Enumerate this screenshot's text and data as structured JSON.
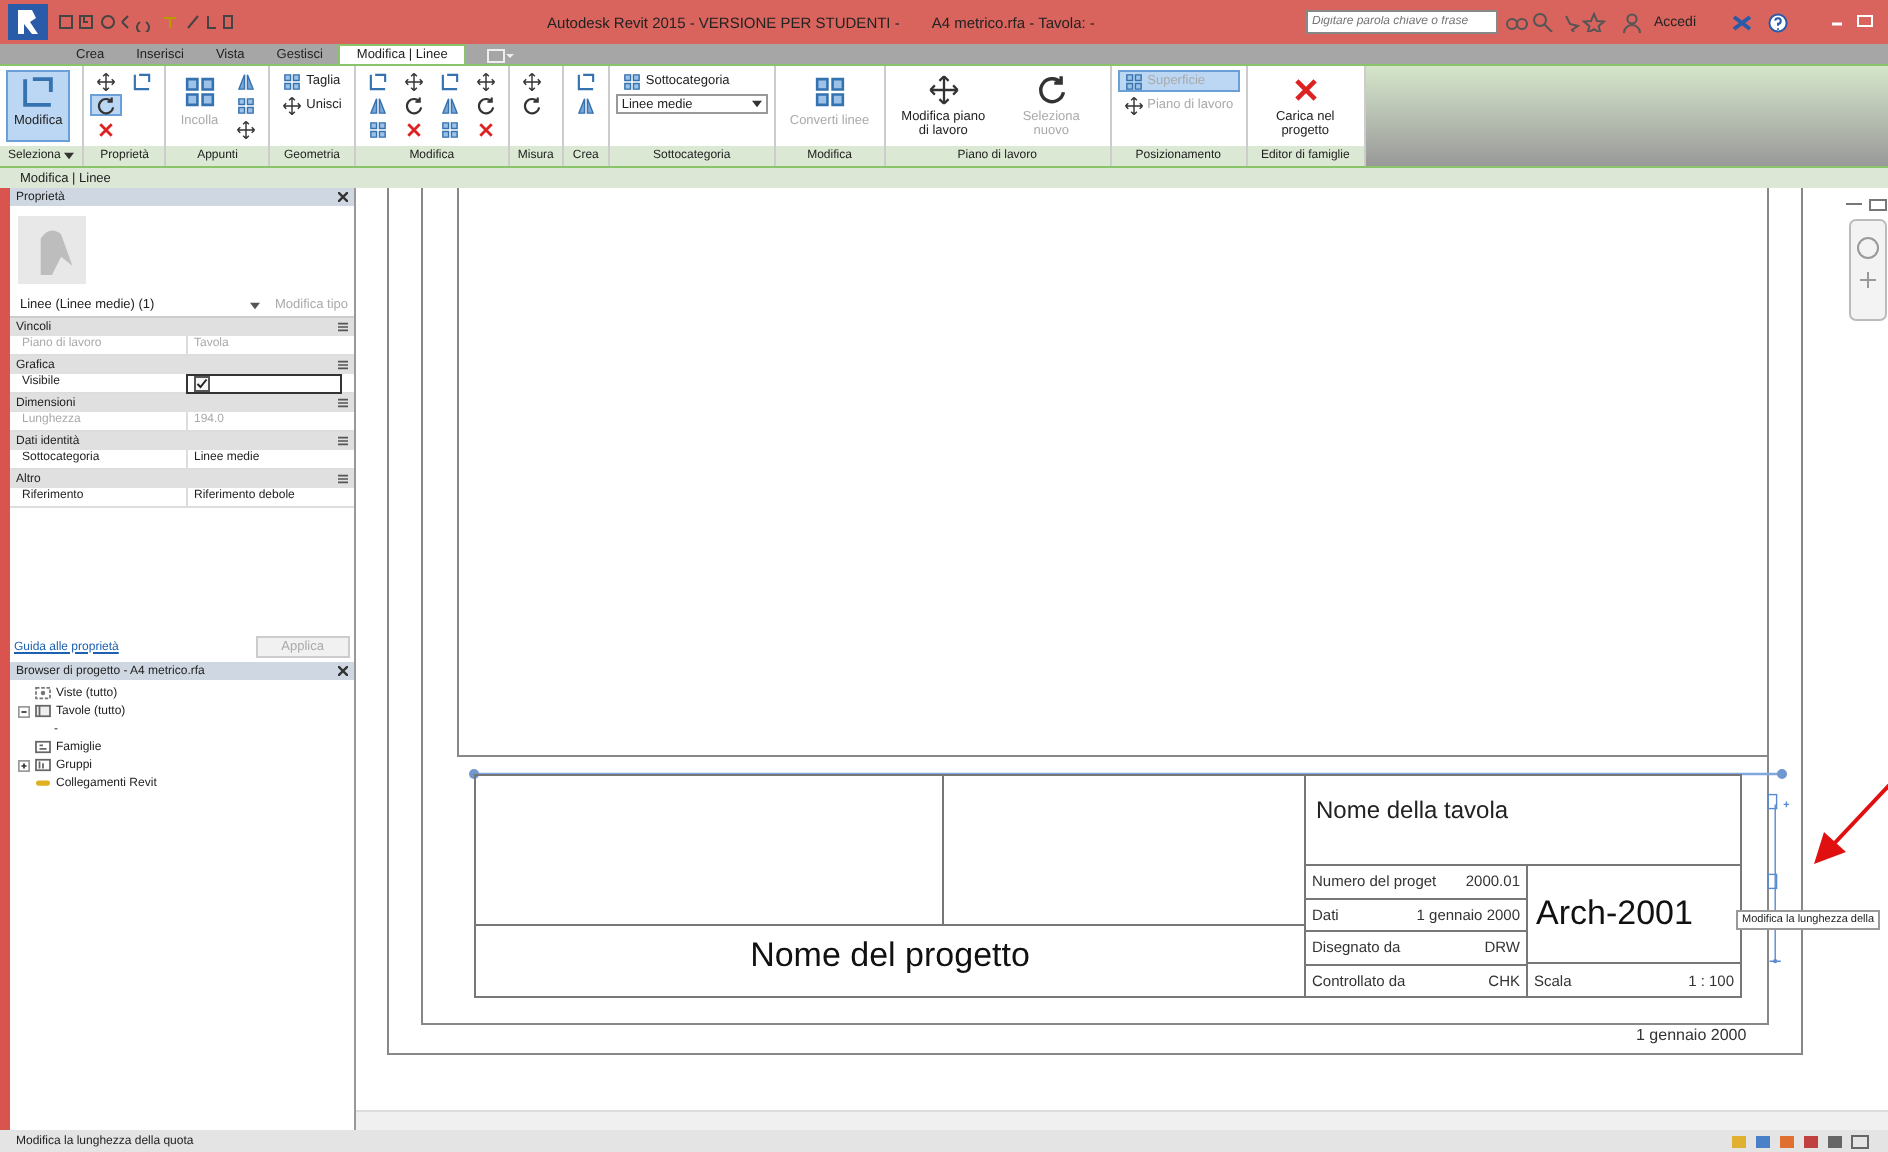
{
  "window": {
    "title": "Autodesk Revit 2015 - VERSIONE PER STUDENTI -",
    "document": "A4 metrico.rfa - Tavola: -"
  },
  "search": {
    "placeholder": "Digitare parola chiave o frase"
  },
  "sign_in": "Accedi",
  "tabs": [
    {
      "label": "Crea",
      "selected": false
    },
    {
      "label": "Inserisci",
      "selected": false
    },
    {
      "label": "Vista",
      "selected": false
    },
    {
      "label": "Gestisci",
      "selected": false
    },
    {
      "label": "Modifica | Linee",
      "selected": true
    }
  ],
  "ribbon": [
    {
      "label": "Seleziona",
      "menu": true,
      "items": [
        {
          "kind": "large",
          "label": "Modifica",
          "selected": true,
          "disabled": false
        }
      ]
    },
    {
      "label": "Proprietà",
      "items": [
        {
          "kind": "tool",
          "selected": false
        },
        {
          "kind": "tool",
          "selected": true
        },
        {
          "kind": "tool",
          "selected": false
        },
        {
          "kind": "tool",
          "selected": false
        }
      ]
    },
    {
      "label": "Appunti",
      "items": [
        {
          "kind": "large",
          "label": "Incolla",
          "selected": false,
          "disabled": true
        },
        {
          "kind": "tool",
          "selected": false
        },
        {
          "kind": "tool",
          "selected": false
        },
        {
          "kind": "tool",
          "selected": false
        }
      ]
    },
    {
      "label": "Geometria",
      "items": [
        {
          "kind": "small",
          "label": "Taglia",
          "selected": false,
          "disabled": false
        },
        {
          "kind": "small",
          "label": "Unisci",
          "selected": false,
          "disabled": false
        }
      ]
    },
    {
      "label": "Modifica",
      "items": [
        {
          "kind": "tool",
          "selected": false
        },
        {
          "kind": "tool",
          "selected": false
        },
        {
          "kind": "tool",
          "selected": false
        },
        {
          "kind": "tool",
          "selected": false
        },
        {
          "kind": "tool",
          "selected": false
        },
        {
          "kind": "tool",
          "selected": false
        },
        {
          "kind": "tool",
          "selected": false
        },
        {
          "kind": "tool",
          "selected": false
        },
        {
          "kind": "tool",
          "selected": false
        },
        {
          "kind": "tool",
          "selected": false
        },
        {
          "kind": "tool",
          "selected": false
        },
        {
          "kind": "tool",
          "selected": false
        }
      ]
    },
    {
      "label": "Misura",
      "items": [
        {
          "kind": "tool",
          "selected": false
        },
        {
          "kind": "tool",
          "selected": false
        }
      ]
    },
    {
      "label": "Crea",
      "items": [
        {
          "kind": "tool",
          "selected": false
        },
        {
          "kind": "tool",
          "selected": false
        }
      ]
    },
    {
      "label": "Sottocategoria",
      "items": [
        {
          "kind": "small",
          "label": "Sottocategoria",
          "selected": false,
          "disabled": false
        },
        {
          "kind": "dropdown",
          "label": "Linee medie"
        }
      ]
    },
    {
      "label": "Modifica",
      "items": [
        {
          "kind": "large",
          "label": "Converti linee",
          "selected": false,
          "disabled": true
        }
      ]
    },
    {
      "label": "Piano di lavoro",
      "items": [
        {
          "kind": "large",
          "label": "Modifica piano di lavoro",
          "selected": false,
          "disabled": false
        },
        {
          "kind": "large",
          "label": "Seleziona nuovo",
          "selected": false,
          "disabled": true
        }
      ]
    },
    {
      "label": "Posizionamento",
      "items": [
        {
          "kind": "small",
          "label": "Superficie",
          "selected": true,
          "disabled": true
        },
        {
          "kind": "small",
          "label": "Piano di lavoro",
          "selected": false,
          "disabled": true
        }
      ]
    },
    {
      "label": "Editor di famiglie",
      "items": [
        {
          "kind": "large",
          "label": "Carica nel progetto",
          "selected": false,
          "disabled": false
        }
      ]
    }
  ],
  "context_bar": "Modifica | Linee",
  "properties": {
    "title": "Proprietà",
    "type_selector": "Linee (Linee medie) (1)",
    "edit_type": {
      "label": "Modifica tipo",
      "disabled": true
    },
    "groups": [
      {
        "name": "Vincoli",
        "rows": [
          {
            "kind": "text",
            "label": "Piano di lavoro",
            "value": "Tavola",
            "disabled": true
          }
        ]
      },
      {
        "name": "Grafica",
        "rows": [
          {
            "kind": "checkbox",
            "label": "Visibile",
            "checked": true,
            "disabled": false
          }
        ]
      },
      {
        "name": "Dimensioni",
        "rows": [
          {
            "kind": "text",
            "label": "Lunghezza",
            "value": "194.0",
            "disabled": true
          }
        ]
      },
      {
        "name": "Dati identità",
        "rows": [
          {
            "kind": "text",
            "label": "Sottocategoria",
            "value": "Linee medie",
            "disabled": false
          }
        ]
      },
      {
        "name": "Altro",
        "rows": [
          {
            "kind": "text",
            "label": "Riferimento",
            "value": "Riferimento debole",
            "disabled": false
          }
        ]
      }
    ],
    "help_link": "Guida alle proprietà",
    "apply": {
      "label": "Applica",
      "disabled": true
    }
  },
  "browser": {
    "title": "Browser di progetto - A4 metrico.rfa",
    "items": [
      {
        "kind": "views",
        "label": "Viste (tutto)"
      },
      {
        "kind": "sheets",
        "label": "Tavole (tutto)",
        "expanded": true,
        "children": [
          {
            "label": "-"
          }
        ]
      },
      {
        "kind": "families",
        "label": "Famiglie"
      },
      {
        "kind": "groups",
        "label": "Gruppi",
        "expanded": false
      },
      {
        "kind": "links",
        "label": "Collegamenti Revit"
      }
    ]
  },
  "title_block": {
    "project_name": "Nome del progetto",
    "sheet_name": "Nome della tavola",
    "fields": [
      {
        "label": "Numero del proget",
        "value": "2000.01"
      },
      {
        "label": "Dati",
        "value": "1 gennaio 2000"
      },
      {
        "label": "Disegnato da",
        "value": "DRW"
      },
      {
        "label": "Controllato da",
        "value": "CHK"
      }
    ],
    "sheet_number": "Arch-2001",
    "scale": {
      "label": "Scala",
      "value": "1 : 100"
    },
    "date": "1 gennaio 2000"
  },
  "tooltip": "Modifica la lunghezza della",
  "status_bar": "Modifica la lunghezza della quota"
}
